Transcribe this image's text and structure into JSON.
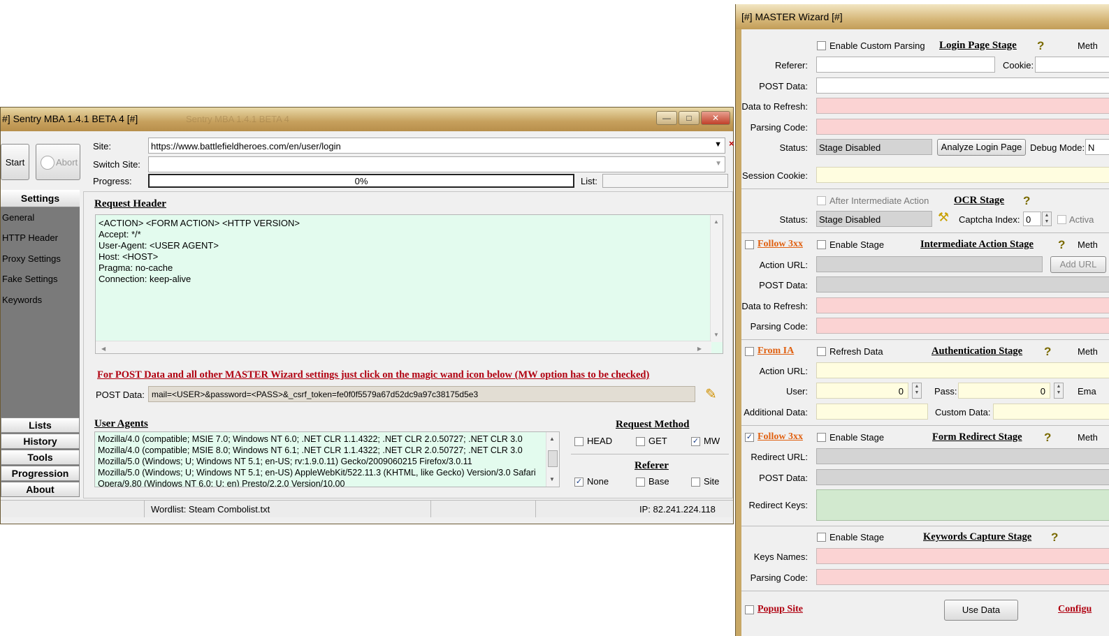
{
  "sentry": {
    "title": "#] Sentry MBA 1.4.1 BETA 4 [#]",
    "ghost_title": "Sentry MBA 1.4.1 BETA 4",
    "minimize": "—",
    "maximize": "□",
    "close": "✕",
    "start_label": "Start",
    "abort_label": "Abort",
    "site_label": "Site:",
    "site_value": "https://www.battlefieldheroes.com/en/user/login",
    "switch_site_label": "Switch Site:",
    "progress_label": "Progress:",
    "progress_text": "0%",
    "progress_value": 0,
    "list_label": "List:",
    "sidebar": {
      "settings_header": "Settings",
      "items": [
        "General",
        "HTTP Header",
        "Proxy Settings",
        "Fake Settings",
        "Keywords"
      ],
      "buttons": [
        "Lists",
        "History",
        "Tools",
        "Progression",
        "About"
      ]
    },
    "request_header_title": "Request Header",
    "request_header_lines": [
      "<ACTION> <FORM ACTION> <HTTP VERSION>",
      "Accept: */*",
      "User-Agent: <USER AGENT>",
      "Host: <HOST>",
      "Pragma: no-cache",
      "Connection: keep-alive"
    ],
    "mw_notice": "For POST Data and all other MASTER Wizard settings just click on the magic wand icon below (MW option has to be checked)",
    "post_data_label": "POST Data:",
    "post_data_value": "mail=<USER>&password=<PASS>&_csrf_token=fe0f0f5579a67d52dc9a97c38175d5e3",
    "user_agents_title": "User Agents",
    "user_agents": [
      "Mozilla/4.0 (compatible; MSIE 7.0; Windows NT 6.0; .NET CLR 1.1.4322; .NET CLR 2.0.50727; .NET CLR 3.0",
      "Mozilla/4.0 (compatible; MSIE 8.0; Windows NT 6.1; .NET CLR 1.1.4322; .NET CLR 2.0.50727; .NET CLR 3.0",
      "Mozilla/5.0 (Windows; U; Windows NT 5.1; en-US; rv:1.9.0.11) Gecko/2009060215 Firefox/3.0.11",
      "Mozilla/5.0 (Windows; U; Windows NT 5.1; en-US) AppleWebKit/522.11.3 (KHTML, like Gecko) Version/3.0 Safari",
      "Opera/9.80 (Windows NT 6.0; U; en) Presto/2.2.0 Version/10.00"
    ],
    "request_method_title": "Request Method",
    "method_head": "HEAD",
    "method_get": "GET",
    "method_mw": "MW",
    "referer_title": "Referer",
    "referer_none": "None",
    "referer_base": "Base",
    "referer_site": "Site",
    "status_wordlist": "Wordlist: Steam Combolist.txt",
    "status_ip": "IP: 82.241.224.118"
  },
  "mw": {
    "title": "[#] MASTER Wizard [#]",
    "login": {
      "enable_custom_parsing": "Enable Custom Parsing",
      "title": "Login Page Stage",
      "meth": "Meth",
      "referer_label": "Referer:",
      "cookie_label": "Cookie:",
      "post_data_label": "POST Data:",
      "data_refresh_label": "Data to Refresh:",
      "parsing_code_label": "Parsing Code:",
      "status_label": "Status:",
      "status_value": "Stage Disabled",
      "analyze_button": "Analyze Login Page",
      "debug_mode": "Debug Mode:",
      "debug_value": "N",
      "session_cookie_label": "Session Cookie:"
    },
    "ocr": {
      "after_intermediate": "After Intermediate Action",
      "title": "OCR Stage",
      "status_label": "Status:",
      "status_value": "Stage Disabled",
      "captcha_index_label": "Captcha Index:",
      "captcha_index_value": "0",
      "activa": "Activa"
    },
    "intermediate": {
      "follow": "Follow 3xx",
      "enable_stage": "Enable Stage",
      "title": "Intermediate Action Stage",
      "meth": "Meth",
      "action_url_label": "Action URL:",
      "add_url_button": "Add URL",
      "post_data_label": "POST Data:",
      "data_refresh_label": "Data to Refresh:",
      "parsing_code_label": "Parsing Code:"
    },
    "auth": {
      "from_ia": "From IA",
      "refresh_data": "Refresh Data",
      "title": "Authentication Stage",
      "meth": "Meth",
      "action_url_label": "Action URL:",
      "user_label": "User:",
      "user_value": "0",
      "pass_label": "Pass:",
      "pass_value": "0",
      "ema": "Ema",
      "additional_data_label": "Additional Data:",
      "custom_data_label": "Custom Data:"
    },
    "redirect": {
      "follow": "Follow 3xx",
      "enable_stage": "Enable Stage",
      "title": "Form Redirect Stage",
      "meth": "Meth",
      "redirect_url_label": "Redirect URL:",
      "post_data_label": "POST Data:",
      "redirect_keys_label": "Redirect Keys:"
    },
    "keywords": {
      "enable_stage": "Enable Stage",
      "title": "Keywords Capture Stage",
      "keys_names_label": "Keys Names:",
      "parsing_code_label": "Parsing Code:"
    },
    "popup_site": "Popup Site",
    "use_data_button": "Use Data",
    "configu": "Configu"
  },
  "colors": {
    "title_bar": "#c6a05d",
    "request_header_bg": "#e3fbee",
    "pink_field": "#fbd3d3",
    "yellow_field": "#fffde0",
    "green_field": "#d2e9cf",
    "notice_red": "#b00010",
    "orange_link": "#e06010"
  },
  "icons": [
    "magic-wand-icon",
    "help-icon",
    "checkbox-icon"
  ]
}
